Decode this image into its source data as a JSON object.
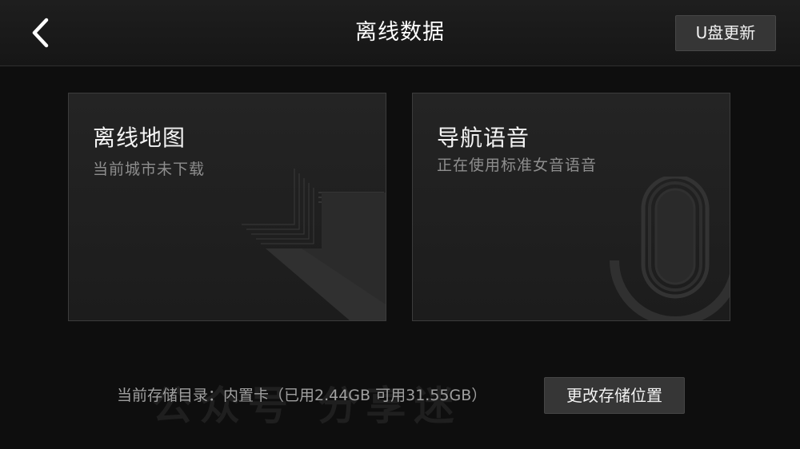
{
  "header": {
    "title": "离线数据",
    "usb_update_label": "U盘更新"
  },
  "cards": {
    "offline_map": {
      "title": "离线地图",
      "subtitle": "当前城市未下载",
      "icon": "download-arrow-icon"
    },
    "nav_voice": {
      "title": "导航语音",
      "subtitle": "正在使用标准女音语音",
      "icon": "microphone-icon"
    }
  },
  "storage": {
    "text": "当前存储目录：内置卡（已用2.44GB 可用31.55GB）",
    "change_label": "更改存储位置"
  },
  "watermark": "公众号 分享迷",
  "colors": {
    "background": "#0e0e0e",
    "card": "#222222",
    "button": "#363636",
    "subtitle_text": "#8e8e8e"
  }
}
